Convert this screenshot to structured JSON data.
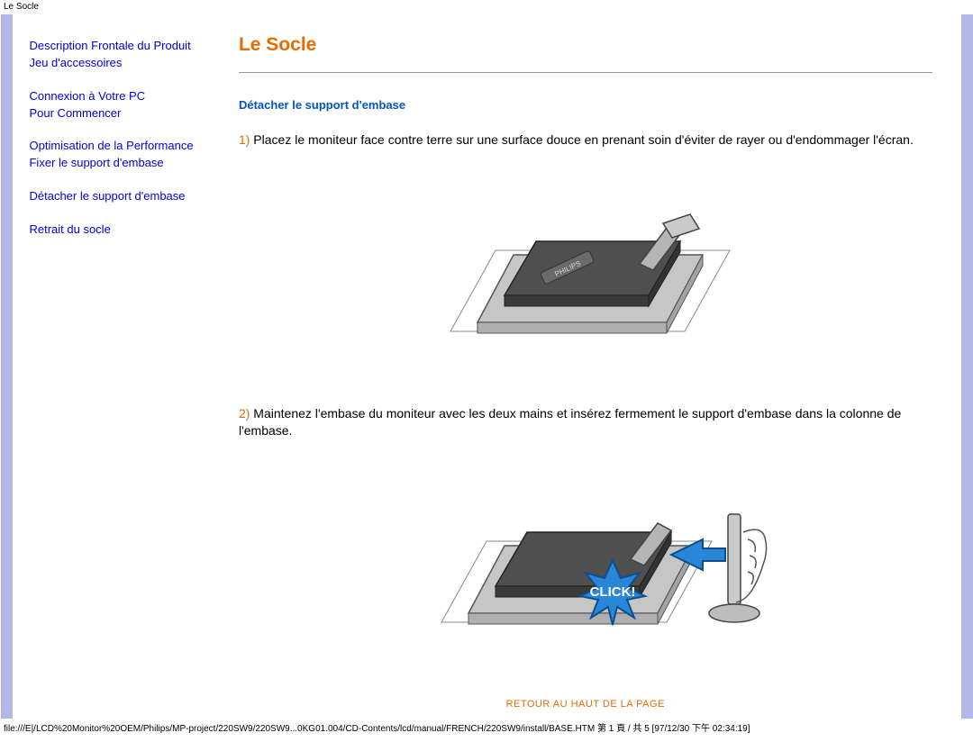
{
  "top_bar": "Le Socle",
  "sidebar": {
    "items": [
      {
        "label": "Description Frontale du Produit"
      },
      {
        "label": "Jeu d'accessoires"
      },
      {
        "label": "Connexion à Votre PC"
      },
      {
        "label": "Pour Commencer"
      },
      {
        "label": "Optimisation de la Performance"
      },
      {
        "label": "Fixer le support d'embase"
      },
      {
        "label": "Détacher le support d'embase"
      },
      {
        "label": "Retrait du socle"
      }
    ]
  },
  "main": {
    "title": "Le Socle",
    "section_heading": "Détacher le support d'embase",
    "step1_num": "1)",
    "step1_text": " Placez le moniteur face contre terre sur une surface douce en prenant soin d'éviter de rayer ou d'endommager l'écran.",
    "step2_num": "2)",
    "step2_text": " Maintenez l'embase du moniteur avec les deux mains et insérez fermement le support d'embase dans la colonne de l'embase.",
    "click_label": "CLICK!",
    "brand": "PHILIPS",
    "return_link": "RETOUR AU HAUT DE LA PAGE"
  },
  "footer_path": "file:///E|/LCD%20Monitor%20OEM/Philips/MP-project/220SW9/220SW9...0KG01.004/CD-Contents/lcd/manual/FRENCH/220SW9/install/BASE.HTM 第 1 頁 / 共 5  [97/12/30 下午 02:34:19]"
}
